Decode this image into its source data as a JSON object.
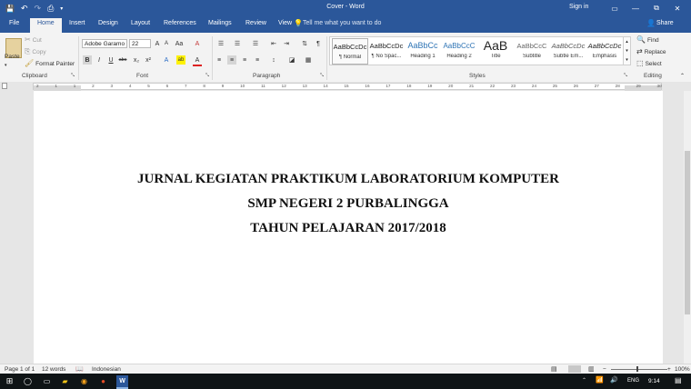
{
  "window": {
    "title": "Cover - Word",
    "sign_in": "Sign in",
    "min": "—",
    "restore": "⧉",
    "close": "✕",
    "ribbon_opts": "▭"
  },
  "qa": {
    "save": "💾",
    "undo": "↶",
    "redo": "↷",
    "print": "⎙",
    "more": "▾"
  },
  "tabs": [
    "File",
    "Home",
    "Insert",
    "Design",
    "Layout",
    "References",
    "Mailings",
    "Review",
    "View"
  ],
  "tell_me": "Tell me what you want to do",
  "share": "Share",
  "clipboard": {
    "paste": "Paste",
    "cut": "Cut",
    "copy": "Copy",
    "format_painter": "Format Painter",
    "group": "Clipboard"
  },
  "font": {
    "name": "Adobe Garamo",
    "size": "22",
    "group": "Font",
    "bold": "B",
    "italic": "I",
    "underline": "U",
    "strike": "abc",
    "sub": "x₂",
    "sup": "x²",
    "grow": "A",
    "shrink": "A",
    "case": "Aa",
    "clear": "A",
    "effects": "A",
    "highlight": "ab",
    "color": "A"
  },
  "paragraph": {
    "group": "Paragraph",
    "pilcrow": "¶"
  },
  "styles": {
    "group": "Styles",
    "items": [
      {
        "preview": "AaBbCcDc",
        "name": "¶ Normal"
      },
      {
        "preview": "AaBbCcDc",
        "name": "¶ No Spac..."
      },
      {
        "preview": "AaBbCc",
        "name": "Heading 1"
      },
      {
        "preview": "AaBbCcC",
        "name": "Heading 2"
      },
      {
        "preview": "AaB",
        "name": "Title"
      },
      {
        "preview": "AaBbCcC",
        "name": "Subtitle"
      },
      {
        "preview": "AaBbCcDc",
        "name": "Subtle Em..."
      },
      {
        "preview": "AaBbCcDc",
        "name": "Emphasis"
      }
    ]
  },
  "editing": {
    "find": "Find",
    "replace": "Replace",
    "select": "Select",
    "group": "Editing"
  },
  "ruler": {
    "numbers": [
      "2",
      "1",
      "1",
      "2",
      "3",
      "4",
      "5",
      "6",
      "7",
      "8",
      "9",
      "10",
      "11",
      "12",
      "13",
      "14",
      "15",
      "16",
      "17",
      "18",
      "19",
      "20",
      "21",
      "22",
      "23",
      "24",
      "25",
      "26",
      "27",
      "28",
      "29",
      "30"
    ]
  },
  "document": {
    "lines": [
      "JURNAL KEGIATAN PRAKTIKUM LABORATORIUM KOMPUTER",
      "SMP NEGERI 2 PURBALINGGA",
      "TAHUN PELAJARAN 2017/2018"
    ]
  },
  "status": {
    "page": "Page 1 of 1",
    "words": "12 words",
    "language": "Indonesian",
    "zoom_minus": "−",
    "zoom_plus": "+",
    "zoom": "100%"
  },
  "taskbar": {
    "lang": "ENG",
    "time": "9:14"
  },
  "colors": {
    "word_blue": "#2b579a"
  }
}
